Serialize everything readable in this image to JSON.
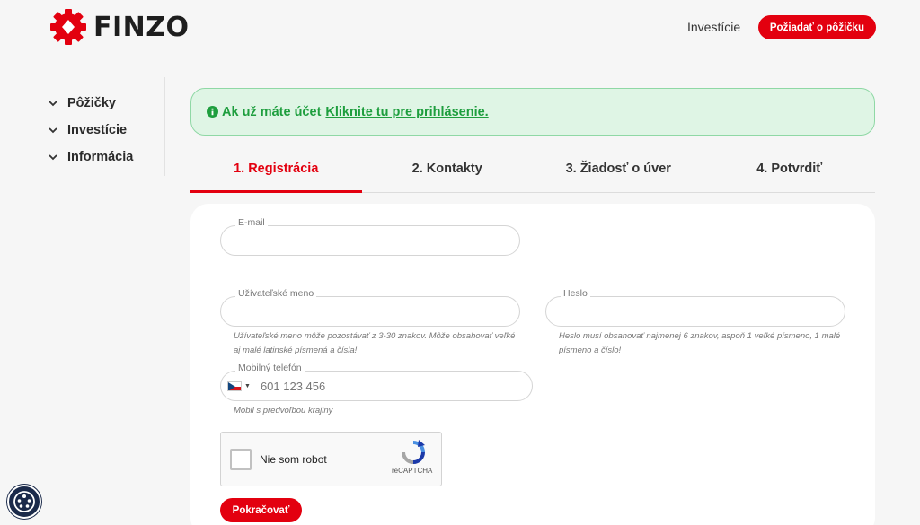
{
  "brand": {
    "name": "FINZO",
    "accent": "#e3000f",
    "success": "#1e9e3e"
  },
  "header": {
    "nav_invest": "Investície",
    "cta": "Požiadať o pôžičku"
  },
  "sidebar": {
    "items": [
      {
        "label": "Pôžičky"
      },
      {
        "label": "Investície"
      },
      {
        "label": "Informácia"
      }
    ]
  },
  "alert": {
    "text": "Ak už máte účet",
    "link": "Kliknite tu pre prihlásenie."
  },
  "steps": [
    {
      "label": "1. Registrácia"
    },
    {
      "label": "2. Kontakty"
    },
    {
      "label": "3. Žiadosť o úver"
    },
    {
      "label": "4. Potvrdiť"
    }
  ],
  "form": {
    "email": {
      "label": "E-mail",
      "value": ""
    },
    "username": {
      "label": "Užívateľské meno",
      "value": "",
      "hint": "Užívateľské meno môže pozostávať z 3-30 znakov. Môže obsahovať veľké aj malé latinské písmená a čísla!"
    },
    "password": {
      "label": "Heslo",
      "value": "",
      "hint": "Heslo musí obsahovať najmenej 6 znakov, aspoň 1 veľké písmeno, 1 malé písmeno a číslo!"
    },
    "phone": {
      "label": "Mobilný telefón",
      "placeholder": "601 123 456",
      "country": "CZ",
      "hint": "Mobil s predvoľbou krajiny"
    },
    "captcha": {
      "label": "Nie som robot",
      "brand": "reCAPTCHA"
    },
    "submit": "Pokračovať"
  }
}
